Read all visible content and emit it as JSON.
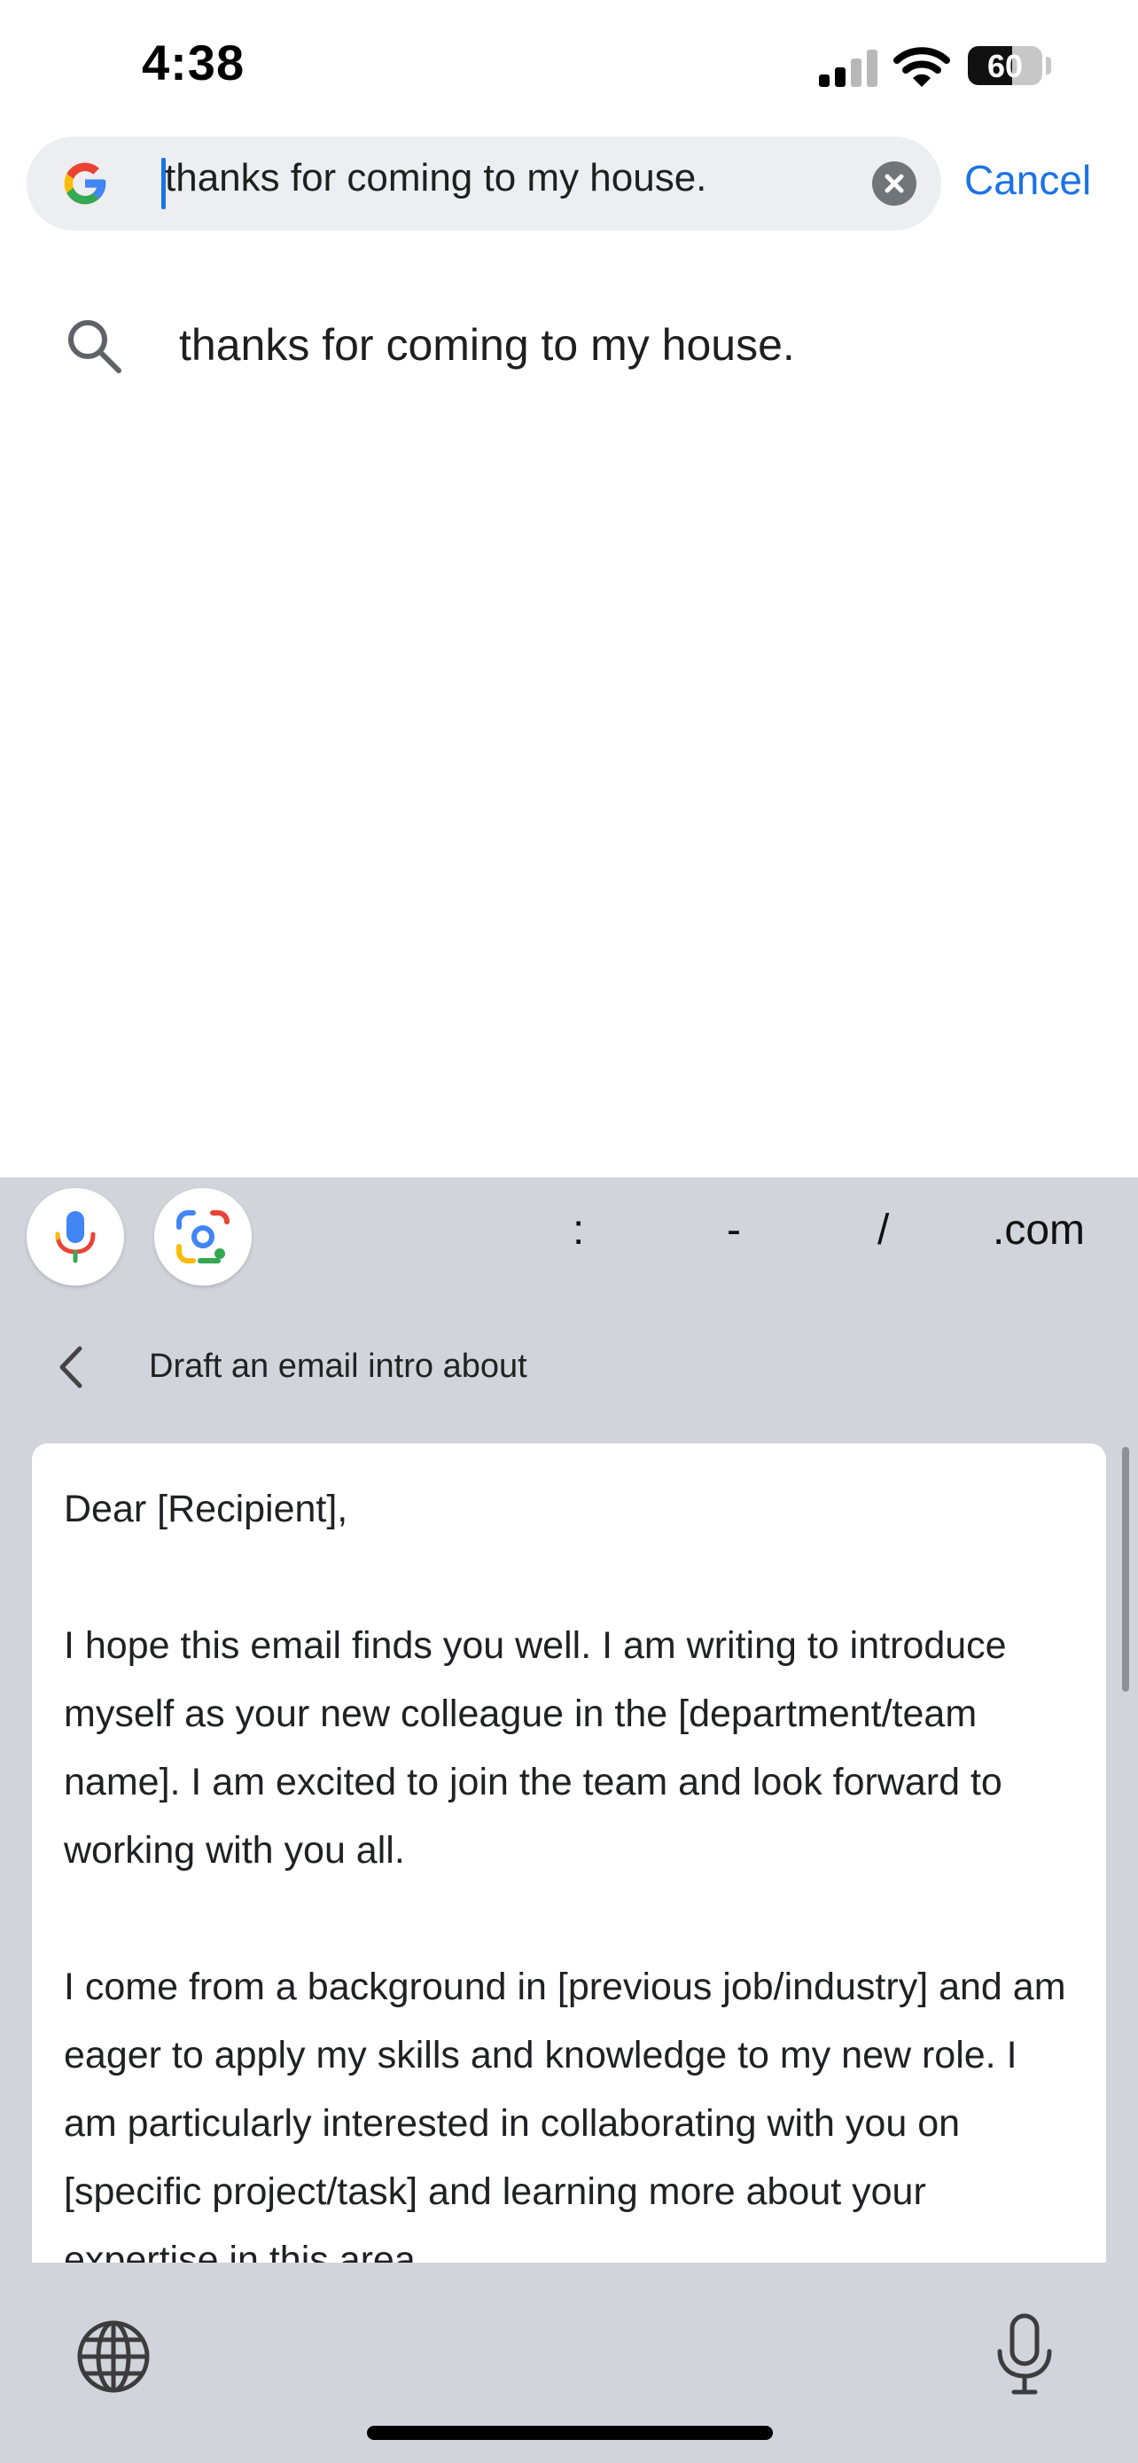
{
  "status_bar": {
    "time": "4:38",
    "battery_level": "60",
    "battery_fraction": 0.6
  },
  "search": {
    "query": "thanks for coming to my house.",
    "cancel_label": "Cancel",
    "icon": "google-g-logo"
  },
  "suggestions": [
    {
      "text": "thanks for coming to my house.",
      "icon": "search-icon"
    }
  ],
  "keyboard_toolbar": {
    "tools": [
      "microphone-icon",
      "google-lens-icon"
    ],
    "quick_keys": [
      ":",
      "-",
      "/",
      ".com"
    ]
  },
  "ai_draft": {
    "title": "Draft an email intro about",
    "paragraphs": [
      "Dear [Recipient],",
      "I hope this email finds you well. I am writing to introduce myself as your new colleague in the [department/team name]. I am excited to join the team and look forward to working with you all.",
      "I come from a background in [previous job/industry] and am eager to apply my skills and knowledge to my new role. I am particularly interested in collaborating with you on [specific project/task] and learning more about your expertise in this area."
    ]
  },
  "colors": {
    "accent": "#1a73e8",
    "keyboard_bg": "#d1d4db",
    "search_bg": "#eceef1",
    "google_blue": "#4285F4",
    "google_red": "#EA4335",
    "google_yellow": "#FBBC05",
    "google_green": "#34A853"
  }
}
